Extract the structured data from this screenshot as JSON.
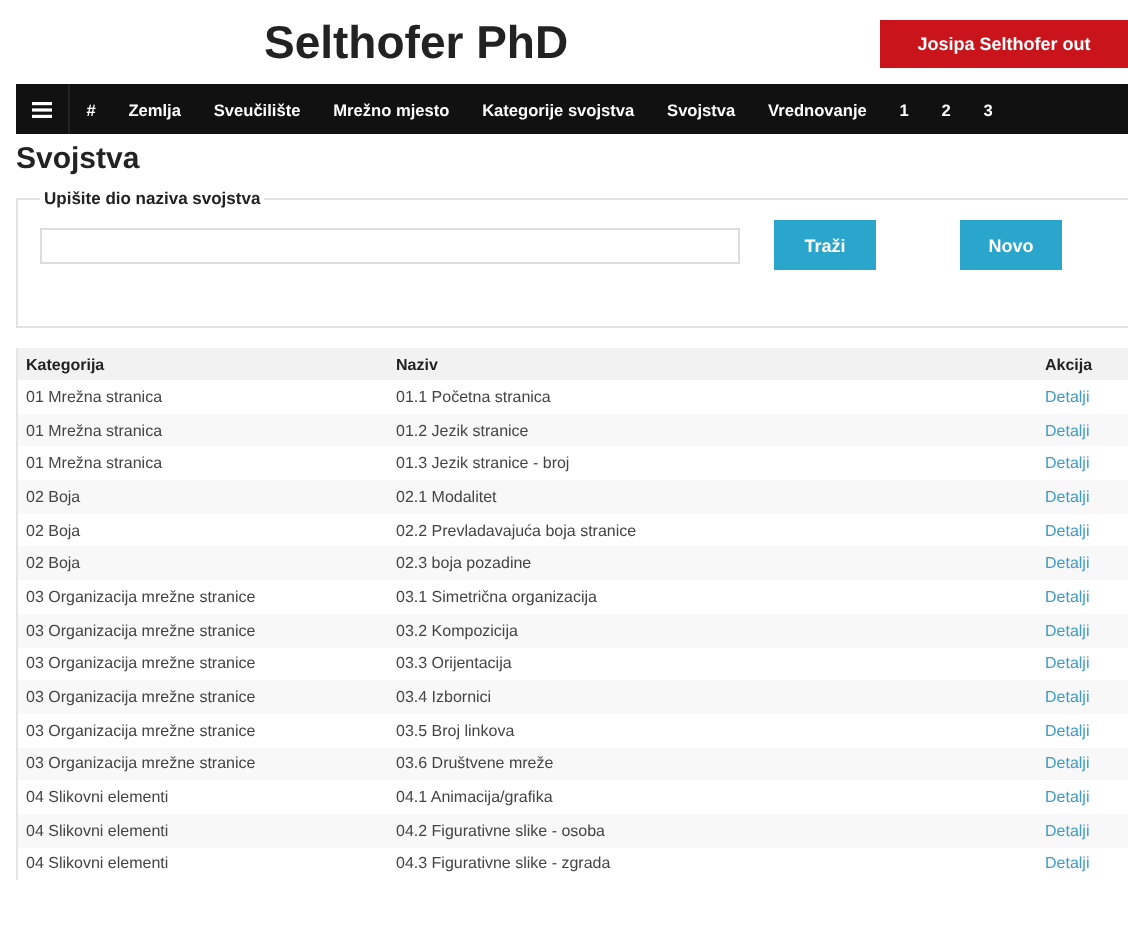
{
  "header": {
    "title": "Selthofer PhD",
    "logout_button": "Josipa Selthofer out"
  },
  "nav": {
    "items": [
      "#",
      "Zemlja",
      "Sveučilište",
      "Mrežno mjesto",
      "Kategorije svojstva",
      "Svojstva",
      "Vrednovanje",
      "1",
      "2",
      "3"
    ]
  },
  "page_title": "Svojstva",
  "search": {
    "legend": "Upišite dio naziva svojstva",
    "search_button": "Traži",
    "new_button": "Novo"
  },
  "table": {
    "columns": [
      "Kategorija",
      "Naziv",
      "Akcija"
    ],
    "rows": [
      [
        "01 Mrežna stranica",
        "01.1 Početna stranica",
        "Detalji"
      ],
      [
        "01 Mrežna stranica",
        "01.2 Jezik stranice",
        "Detalji"
      ],
      [
        "01 Mrežna stranica",
        "01.3 Jezik stranice - broj",
        "Detalji"
      ],
      [
        "02 Boja",
        "02.1 Modalitet",
        "Detalji"
      ],
      [
        "02 Boja",
        "02.2 Prevladavajuća boja stranice",
        "Detalji"
      ],
      [
        "02 Boja",
        "02.3 boja pozadine",
        "Detalji"
      ],
      [
        "03 Organizacija mrežne stranice",
        "03.1 Simetrična organizacija",
        "Detalji"
      ],
      [
        "03 Organizacija mrežne stranice",
        "03.2 Kompozicija",
        "Detalji"
      ],
      [
        "03 Organizacija mrežne stranice",
        "03.3 Orijentacija",
        "Detalji"
      ],
      [
        "03 Organizacija mrežne stranice",
        "03.4 Izbornici",
        "Detalji"
      ],
      [
        "03 Organizacija mrežne stranice",
        "03.5 Broj linkova",
        "Detalji"
      ],
      [
        "03 Organizacija mrežne stranice",
        "03.6 Društvene mreže",
        "Detalji"
      ],
      [
        "04 Slikovni elementi",
        "04.1 Animacija/grafika",
        "Detalji"
      ],
      [
        "04 Slikovni elementi",
        "04.2 Figurativne slike - osoba",
        "Detalji"
      ],
      [
        "04 Slikovni elementi",
        "04.3 Figurativne slike - zgrada",
        "Detalji"
      ]
    ]
  }
}
